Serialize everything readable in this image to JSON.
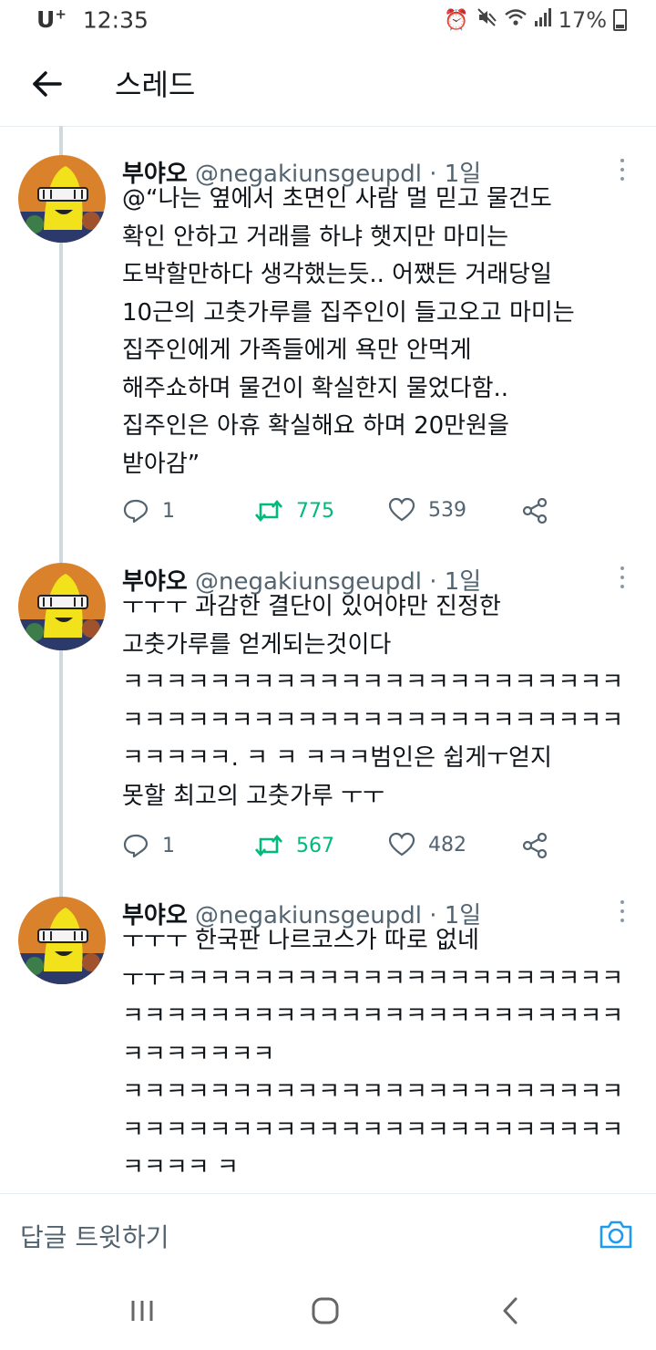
{
  "status_bar": {
    "carrier": "U",
    "carrier_sup": "+",
    "time": "12:35",
    "battery": "17%",
    "icons": [
      "alarm-icon",
      "mute-icon",
      "wifi-icon",
      "signal-icon",
      "battery-icon"
    ]
  },
  "header": {
    "title": "스레드",
    "back_icon": "back-arrow-icon"
  },
  "tweets": [
    {
      "name": "부야오",
      "handle": "@negakiunsgeupdl",
      "time": "1일",
      "text": "@“나는 옆에서 초면인 사람 멀 믿고 물건도\n확인 안하고 거래를 하냐 햇지만 마미는\n도박할만하다 생각했는듯.. 어쨌든 거래당일\n10근의 고춧가루를 집주인이 들고오고 마미는\n집주인에게 가족들에게 욕만 안먹게\n해주쇼하며 물건이 확실한지 물었다함..\n집주인은 아휴 확실해요 하며 20만원을\n받아감”",
      "replies": "1",
      "retweets": "775",
      "likes": "539"
    },
    {
      "name": "부야오",
      "handle": "@negakiunsgeupdl",
      "time": "1일",
      "text": "ㅜㅜㅜ 과감한 결단이 있어야만 진정한\n고춧가루를 얻게되는것이다\nㅋㅋㅋㅋㅋㅋㅋㅋㅋㅋㅋㅋㅋㅋㅋㅋㅋㅋㅋㅋㅋㅋㅋ\nㅋㅋㅋㅋㅋㅋㅋㅋㅋㅋㅋㅋㅋㅋㅋㅋㅋㅋㅋㅋㅋㅋㅋ\nㅋㅋㅋㅋㅋ. ㅋ ㅋ ㅋㅋㅋ범인은 쉽게ㅜ얻지\n못할 최고의 고춧가루 ㅜㅜ",
      "replies": "1",
      "retweets": "567",
      "likes": "482"
    },
    {
      "name": "부야오",
      "handle": "@negakiunsgeupdl",
      "time": "1일",
      "text": "ㅜㅜㅜ 한국판 나르코스가 따로 없네\nㅜㅜㅋㅋㅋㅋㅋㅋㅋㅋㅋㅋㅋㅋㅋㅋㅋㅋㅋㅋㅋㅋㅋ\nㅋㅋㅋㅋㅋㅋㅋㅋㅋㅋㅋㅋㅋㅋㅋㅋㅋㅋㅋㅋㅋㅋㅋ\nㅋㅋㅋㅋㅋㅋㅋ\nㅋㅋㅋㅋㅋㅋㅋㅋㅋㅋㅋㅋㅋㅋㅋㅋㅋㅋㅋㅋㅋㅋㅋ\nㅋㅋㅋㅋㅋㅋㅋㅋㅋㅋㅋㅋㅋㅋㅋㅋㅋㅋㅋㅋㅋㅋㅋ\nㅋㅋㅋㅋ ㅋ"
    }
  ],
  "reply_bar": {
    "placeholder": "답글 트윗하기",
    "icon": "camera-icon"
  },
  "colors": {
    "retweet": "#00ba7c",
    "muted": "#536471",
    "divider": "#e6ecf0",
    "link": "#1d9bf0"
  }
}
